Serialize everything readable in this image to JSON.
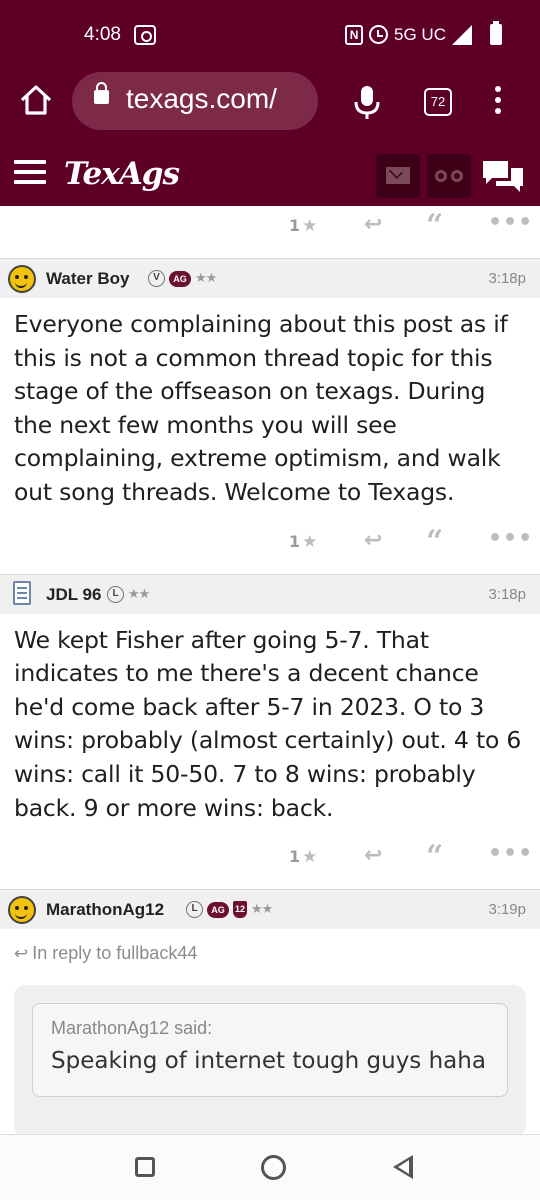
{
  "status_bar": {
    "time": "4:08",
    "network": "5G UC"
  },
  "browser": {
    "url": "texags.com/",
    "tab_count": "72"
  },
  "site": {
    "logo": "TexAgs"
  },
  "top_actions": {
    "star_count": "1"
  },
  "posts": [
    {
      "username": "Water Boy",
      "badges": [
        "V",
        "AG"
      ],
      "stars": "★★",
      "time": "3:18p",
      "body": "Everyone complaining about this post as if this is not a common thread topic for this stage of the offseason on texags. During the next few months you will see complaining, extreme optimism, and walk out song threads. Welcome to Texags.",
      "star_count": "1"
    },
    {
      "username": "JDL 96",
      "badges": [
        "L"
      ],
      "stars": "★★",
      "time": "3:18p",
      "body": "We kept Fisher after going 5-7. That indicates to me there's a decent chance he'd come back after 5-7 in 2023. O to 3 wins: probably (almost certainly) out. 4 to 6 wins: call it 50-50. 7 to 8 wins: probably back. 9 or more wins: back.",
      "star_count": "1"
    },
    {
      "username": "MarathonAg12",
      "badges": [
        "L",
        "AG",
        "12"
      ],
      "stars": "★★",
      "time": "3:19p",
      "reply_to": "In reply to fullback44",
      "quote_author": "MarathonAg12 said:",
      "quote_text": "Speaking of internet tough guys haha"
    }
  ],
  "colors": {
    "brand_maroon": "#5e0026",
    "url_pill": "#7d2a48"
  }
}
